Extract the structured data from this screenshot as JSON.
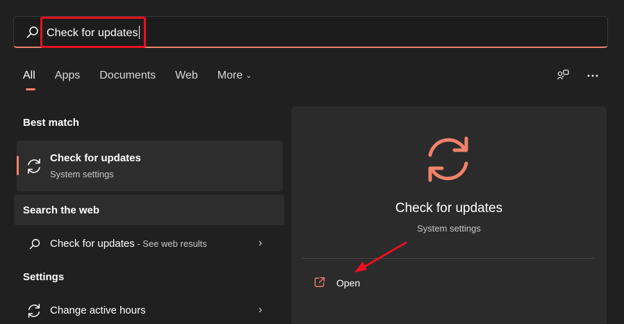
{
  "search": {
    "query": "Check for updates"
  },
  "tabs": [
    {
      "label": "All"
    },
    {
      "label": "Apps"
    },
    {
      "label": "Documents"
    },
    {
      "label": "Web"
    },
    {
      "label": "More"
    }
  ],
  "sections": {
    "best_match": "Best match",
    "search_web": "Search the web",
    "settings": "Settings"
  },
  "best_match": {
    "title": "Check for updates",
    "subtitle": "System settings"
  },
  "web_result": {
    "title": "Check for updates",
    "suffix": " - See web results"
  },
  "settings_result": {
    "title": "Change active hours"
  },
  "detail": {
    "title": "Check for updates",
    "subtitle": "System settings",
    "open_label": "Open"
  },
  "colors": {
    "accent": "#f0826a",
    "annotation_red": "#e81123",
    "background": "#202020",
    "panel": "#2b2b2b"
  },
  "icons": [
    "search-icon",
    "refresh-icon",
    "chevron-down-icon",
    "chevron-right-icon",
    "share-icon",
    "more-icon",
    "open-external-icon"
  ]
}
